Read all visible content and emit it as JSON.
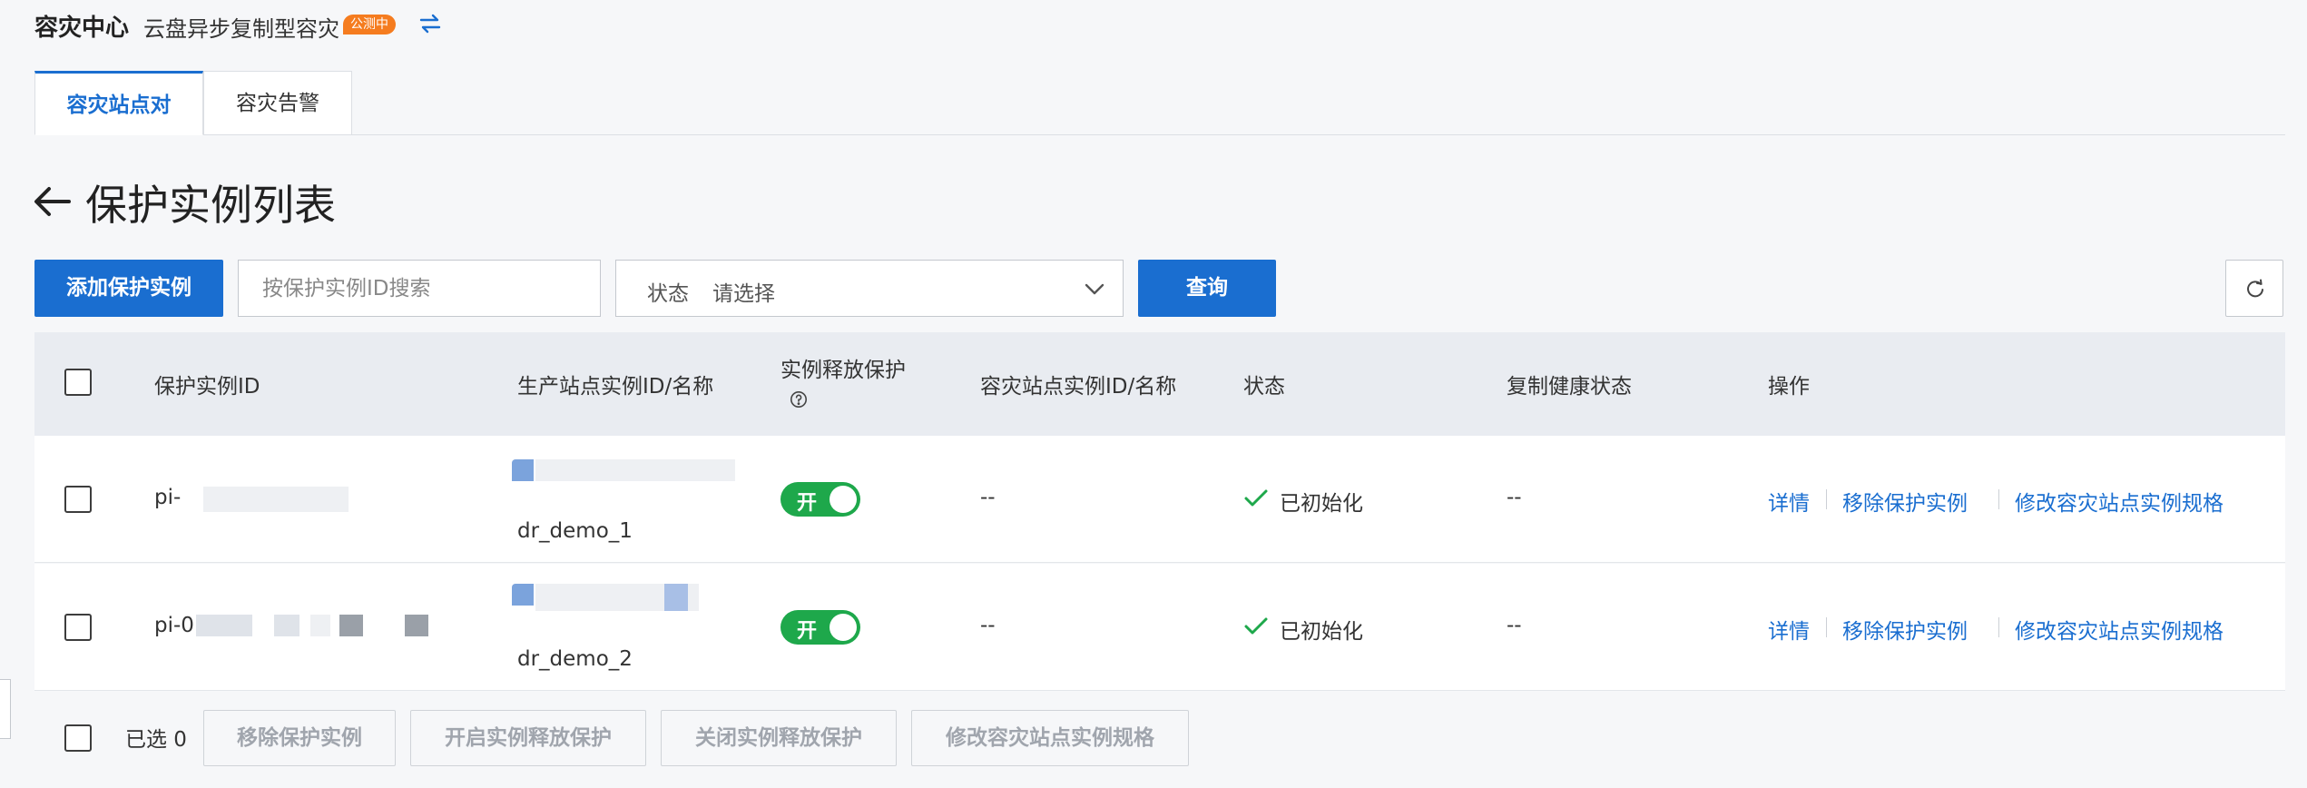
{
  "header": {
    "title": "容灾中心",
    "subtitle": "云盘异步复制型容灾",
    "badge": "公测中"
  },
  "tabs": [
    {
      "label": "容灾站点对",
      "active": true
    },
    {
      "label": "容灾告警",
      "active": false
    }
  ],
  "page": {
    "title": "保护实例列表"
  },
  "toolbar": {
    "add_label": "添加保护实例",
    "search_placeholder": "按保护实例ID搜索",
    "status_label": "状态",
    "status_placeholder": "请选择",
    "query_label": "查询"
  },
  "table": {
    "columns": [
      "保护实例ID",
      "生产站点实例ID/名称",
      "实例释放保护",
      "容灾站点实例ID/名称",
      "状态",
      "复制健康状态",
      "操作"
    ],
    "rows": [
      {
        "id": "pi-",
        "prod_name": "dr_demo_1",
        "release_protection": "开",
        "dr_site": "--",
        "status": "已初始化",
        "health": "--",
        "actions": [
          "详情",
          "移除保护实例",
          "修改容灾站点实例规格"
        ]
      },
      {
        "id": "pi-0",
        "prod_name": "dr_demo_2",
        "release_protection": "开",
        "dr_site": "--",
        "status": "已初始化",
        "health": "--",
        "actions": [
          "详情",
          "移除保护实例",
          "修改容灾站点实例规格"
        ]
      }
    ]
  },
  "footer": {
    "selected": "已选 0",
    "buttons": [
      "移除保护实例",
      "开启实例释放保护",
      "关闭实例释放保护",
      "修改容灾站点实例规格"
    ]
  },
  "colors": {
    "primary": "#1a6ed0",
    "toggle_on": "#1ea84b",
    "badge": "#f57c1f",
    "success": "#1ea84b"
  },
  "icons": [
    "switch-icon",
    "back-arrow-icon",
    "chevron-down-icon",
    "refresh-icon",
    "help-icon",
    "check-icon"
  ]
}
